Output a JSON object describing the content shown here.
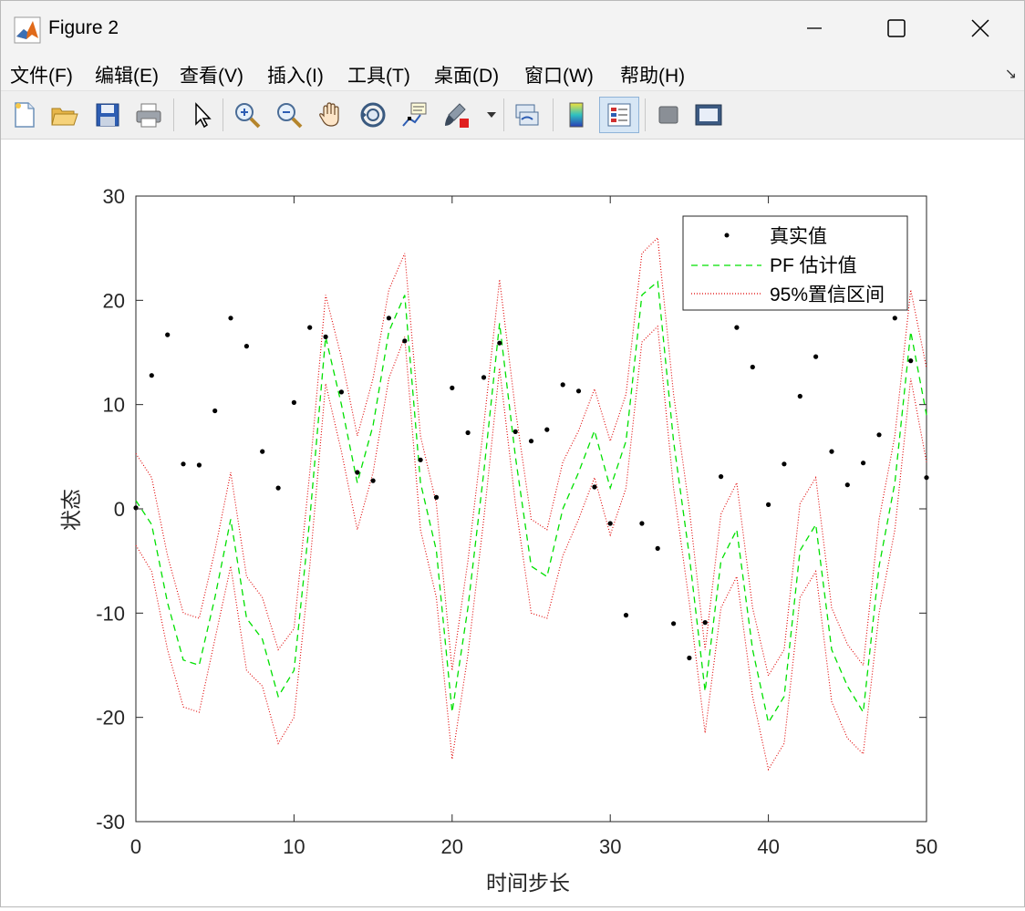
{
  "window": {
    "title": "Figure 2"
  },
  "menu": [
    "文件(F)",
    "编辑(E)",
    "查看(V)",
    "插入(I)",
    "工具(T)",
    "桌面(D)",
    "窗口(W)",
    "帮助(H)"
  ],
  "toolbar": {
    "buttons": [
      {
        "name": "new-figure-icon"
      },
      {
        "name": "open-file-icon"
      },
      {
        "name": "save-icon"
      },
      {
        "name": "print-icon"
      },
      {
        "name": "pointer-arrow-icon"
      },
      {
        "name": "zoom-in-icon"
      },
      {
        "name": "zoom-out-icon"
      },
      {
        "name": "pan-hand-icon"
      },
      {
        "name": "rotate-3d-icon"
      },
      {
        "name": "data-cursor-icon"
      },
      {
        "name": "brush-icon"
      },
      {
        "name": "dropdown-arrow-icon"
      },
      {
        "name": "link-plot-icon"
      },
      {
        "name": "colorbar-icon"
      },
      {
        "name": "legend-icon"
      },
      {
        "name": "hide-plot-tools-icon"
      },
      {
        "name": "show-plot-tools-icon"
      }
    ]
  },
  "chart_data": {
    "type": "line",
    "title": "",
    "xlabel": "时间步长",
    "ylabel": "状态",
    "xlim": [
      0,
      50
    ],
    "ylim": [
      -30,
      30
    ],
    "xticks": [
      "0",
      "10",
      "20",
      "30",
      "40",
      "50"
    ],
    "yticks": [
      "30",
      "20",
      "10",
      "0",
      "-10",
      "-20",
      "-30"
    ],
    "legend_position": "top-right",
    "x": [
      0,
      1,
      2,
      3,
      4,
      5,
      6,
      7,
      8,
      9,
      10,
      11,
      12,
      13,
      14,
      15,
      16,
      17,
      18,
      19,
      20,
      21,
      22,
      23,
      24,
      25,
      26,
      27,
      28,
      29,
      30,
      31,
      32,
      33,
      34,
      35,
      36,
      37,
      38,
      39,
      40,
      41,
      42,
      43,
      44,
      45,
      46,
      47,
      48,
      49,
      50
    ],
    "series": [
      {
        "name": "真实值",
        "style": "dots",
        "color": "#000000",
        "values": [
          0.1,
          12.8,
          16.7,
          4.3,
          4.2,
          9.4,
          18.3,
          15.6,
          5.5,
          2.0,
          10.2,
          17.4,
          16.5,
          11.2,
          3.5,
          2.7,
          18.3,
          16.1,
          4.7,
          1.1,
          11.6,
          7.3,
          12.6,
          15.9,
          7.4,
          6.5,
          7.6,
          11.9,
          11.3,
          2.1,
          -1.4,
          -10.2,
          -1.4,
          -3.8,
          -11.0,
          -14.3,
          -10.9,
          3.1,
          17.4,
          13.6,
          0.4,
          4.3,
          10.8,
          14.6,
          5.5,
          2.3,
          4.4,
          7.1,
          18.3,
          14.2,
          3.0
        ]
      },
      {
        "name": "PF 估计值",
        "style": "dashed",
        "color": "#00e000",
        "values": [
          0.8,
          -1.5,
          -9.0,
          -14.5,
          -15.0,
          -8.5,
          -1.0,
          -10.5,
          -12.5,
          -18.0,
          -15.5,
          -1.0,
          16.5,
          10.0,
          2.5,
          8.0,
          17.0,
          20.5,
          2.5,
          -4.0,
          -19.5,
          -9.5,
          3.5,
          17.8,
          5.0,
          -5.5,
          -6.5,
          0.0,
          3.5,
          7.5,
          2.0,
          6.5,
          20.5,
          21.8,
          6.5,
          -4.5,
          -17.5,
          -5.0,
          -2.0,
          -13.5,
          -20.5,
          -18.0,
          -4.0,
          -1.5,
          -13.5,
          -17.0,
          -19.5,
          -5.5,
          2.5,
          17.0,
          9.0
        ]
      },
      {
        "name": "95%置信区间",
        "style": "dotted",
        "color": "#e00000",
        "upper": [
          5.3,
          3.0,
          -4.5,
          -10.0,
          -10.5,
          -4.0,
          3.5,
          -6.5,
          -8.5,
          -13.5,
          -11.5,
          3.5,
          20.5,
          14.5,
          7.0,
          12.5,
          21.0,
          24.5,
          7.0,
          0.5,
          -15.5,
          -5.0,
          8.0,
          22.0,
          9.5,
          -1.0,
          -2.0,
          4.5,
          7.5,
          11.5,
          6.5,
          11.0,
          24.5,
          26.0,
          11.0,
          0.0,
          -13.5,
          -0.5,
          2.5,
          -9.5,
          -16.0,
          -13.5,
          0.5,
          3.0,
          -9.5,
          -13.0,
          -15.0,
          -1.0,
          7.0,
          21.0,
          13.5
        ],
        "lower": [
          -3.5,
          -6.0,
          -13.5,
          -19.0,
          -19.5,
          -12.5,
          -5.5,
          -15.5,
          -17.0,
          -22.5,
          -20.0,
          -5.5,
          12.0,
          5.5,
          -2.0,
          3.5,
          12.5,
          16.5,
          -2.0,
          -8.5,
          -24.0,
          -14.0,
          -1.0,
          13.5,
          0.5,
          -10.0,
          -10.5,
          -4.5,
          -1.0,
          3.0,
          -2.5,
          2.0,
          16.0,
          17.5,
          2.0,
          -9.0,
          -21.5,
          -9.5,
          -6.5,
          -18.0,
          -25.0,
          -22.5,
          -8.5,
          -6.0,
          -18.5,
          -22.0,
          -23.5,
          -10.0,
          -2.0,
          12.5,
          4.5
        ]
      }
    ]
  }
}
